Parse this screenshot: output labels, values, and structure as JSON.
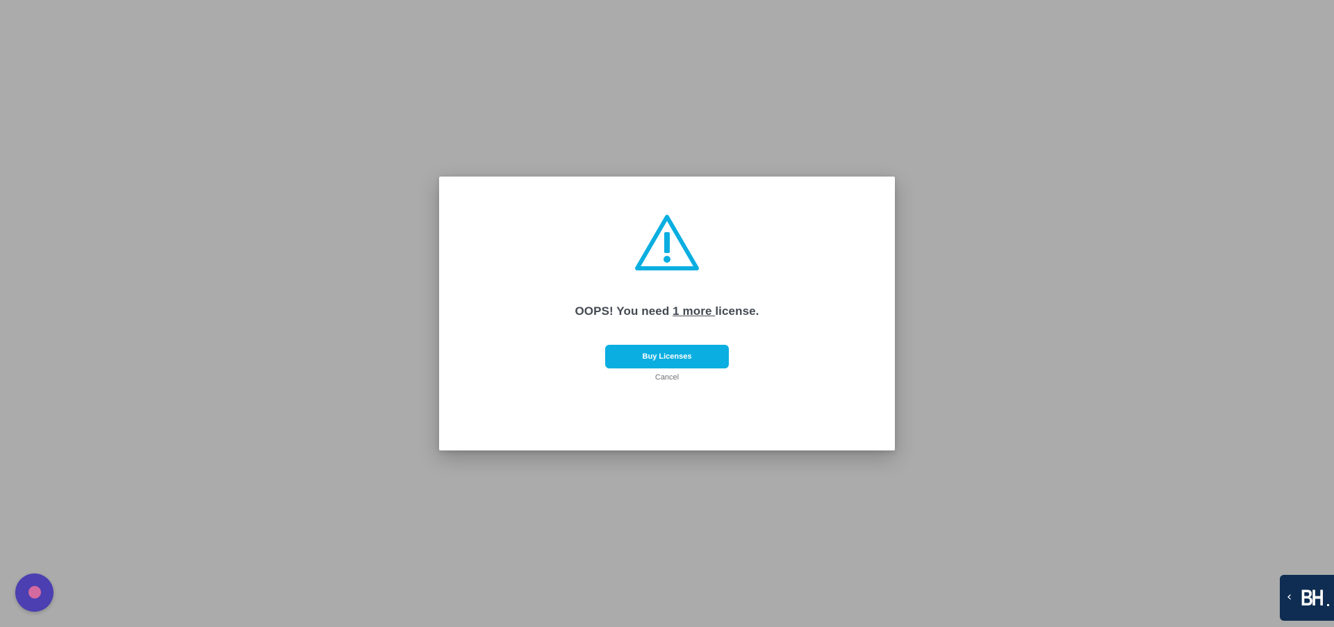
{
  "dialog": {
    "message_prefix": "OOPS! You need ",
    "message_highlight": "1 more ",
    "message_suffix": "license.",
    "primary_button_label": "Buy Licenses",
    "cancel_label": "Cancel",
    "icon": "warning-triangle-icon"
  },
  "chat_widget": {
    "icon": "chat-launcher-icon"
  },
  "brand_tab": {
    "chevron": "‹",
    "logo_text": "BH",
    "icon": "chevron-left-icon"
  },
  "colors": {
    "backdrop": "#ababab",
    "accent": "#0baee0",
    "message_text": "#444a52",
    "chat_launcher": "#4b3fb1",
    "brand_tab": "#0f2d52"
  }
}
